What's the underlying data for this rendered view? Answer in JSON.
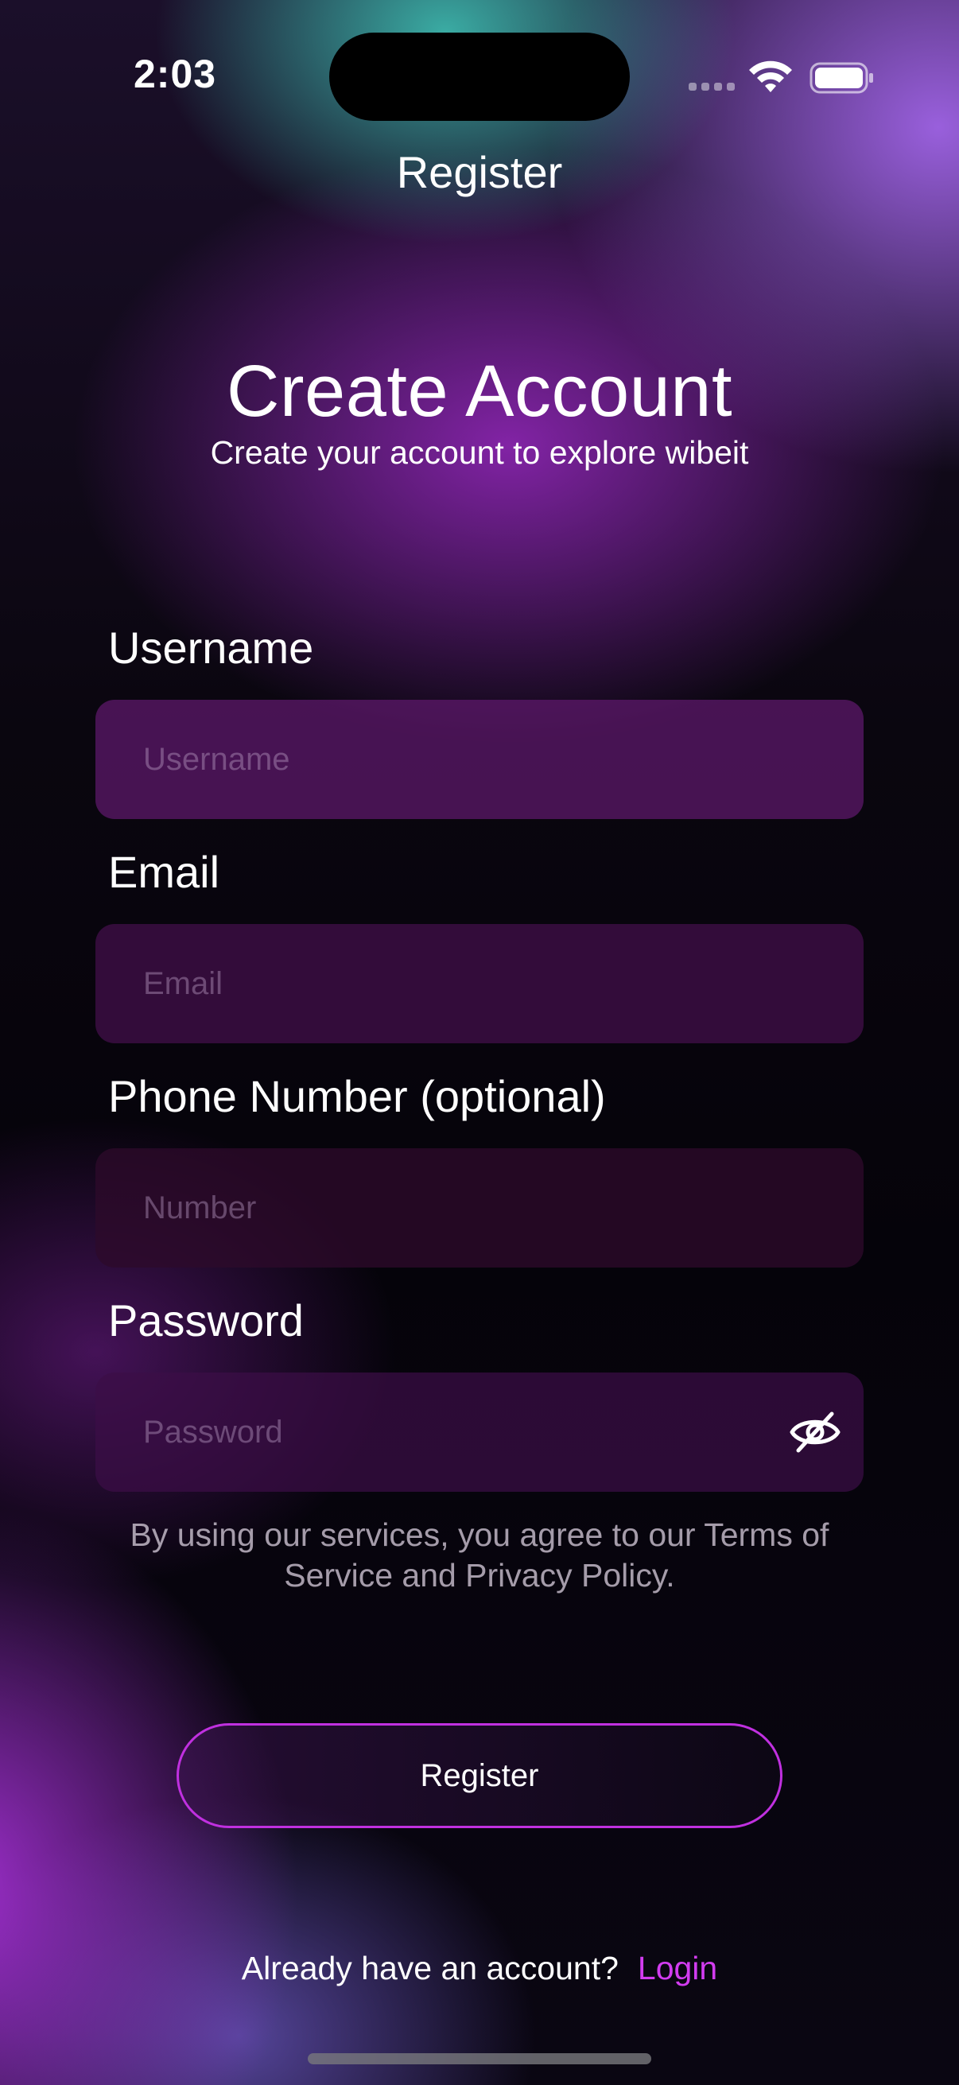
{
  "status_bar": {
    "time": "2:03"
  },
  "nav": {
    "title": "Register"
  },
  "header": {
    "title": "Create Account",
    "subtitle": "Create your account to explore wibeit"
  },
  "form": {
    "username": {
      "label": "Username",
      "placeholder": "Username",
      "value": ""
    },
    "email": {
      "label": "Email",
      "placeholder": "Email",
      "value": ""
    },
    "phone": {
      "label": "Phone Number (optional)",
      "placeholder": "Number",
      "value": ""
    },
    "password": {
      "label": "Password",
      "placeholder": "Password",
      "value": ""
    },
    "terms_text": "By using our services, you agree to our Terms of Service and Privacy Policy.",
    "submit_label": "Register"
  },
  "footer": {
    "prompt": "Already have an account?",
    "login_label": "Login"
  },
  "colors": {
    "accent": "#d23cf0",
    "button_border": "#c030e0"
  },
  "icons": {
    "password_toggle": "eye-slash-icon",
    "wifi": "wifi-icon",
    "battery": "battery-icon",
    "signal": "cellular-signal-icon"
  }
}
